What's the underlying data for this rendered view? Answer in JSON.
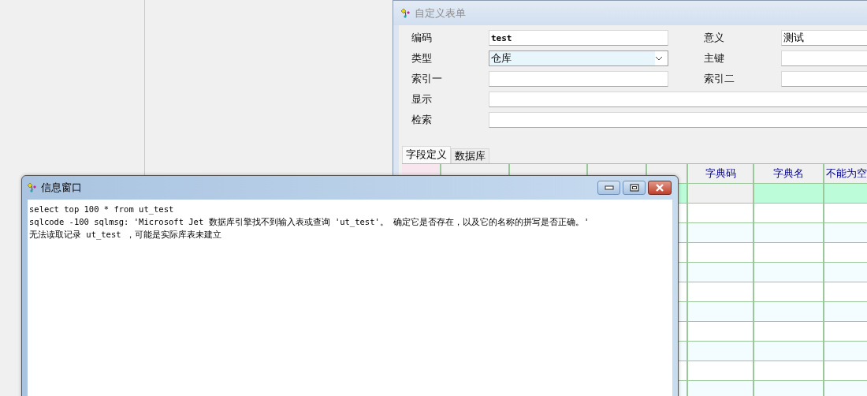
{
  "form_window": {
    "title": "自定义表单",
    "field_rows": [
      {
        "fields": [
          {
            "label": "编码",
            "value": "test",
            "kind": "text"
          },
          {
            "label": "意义",
            "value": "测试",
            "kind": "text"
          }
        ]
      },
      {
        "fields": [
          {
            "label": "类型",
            "value": "仓库",
            "kind": "combo"
          },
          {
            "label": "主键",
            "kind": "text"
          }
        ]
      },
      {
        "fields": [
          {
            "label": "索引一",
            "kind": "text"
          },
          {
            "label": "索引二",
            "kind": "text"
          }
        ]
      },
      {
        "fields": [
          {
            "label": "显示",
            "kind": "wide"
          }
        ]
      },
      {
        "fields": [
          {
            "label": "检索",
            "kind": "wide"
          }
        ]
      }
    ],
    "tabs": [
      {
        "label": "字段定义",
        "selected": true
      },
      {
        "label": "数据库",
        "selected": false
      }
    ],
    "grid": {
      "columns": [
        "字典码",
        "字典名",
        "不能为空"
      ],
      "rows": [
        {
          "selected": true
        },
        {
          "selected": false
        },
        {
          "selected": false
        },
        {
          "selected": false
        },
        {
          "selected": false
        },
        {
          "selected": false
        },
        {
          "selected": false
        },
        {
          "selected": false
        },
        {
          "selected": false
        },
        {
          "selected": false
        },
        {
          "selected": false
        }
      ]
    }
  },
  "info_window": {
    "title": "信息窗口",
    "lines": [
      "select top 100 * from ut_test",
      "sqlcode -100 sqlmsg: 'Microsoft Jet 数据库引擎找不到输入表或查询 'ut_test'。 确定它是否存在，以及它的名称的拼写是否正确。'",
      "无法读取记录 ut_test ，可能是实际库表未建立"
    ]
  }
}
